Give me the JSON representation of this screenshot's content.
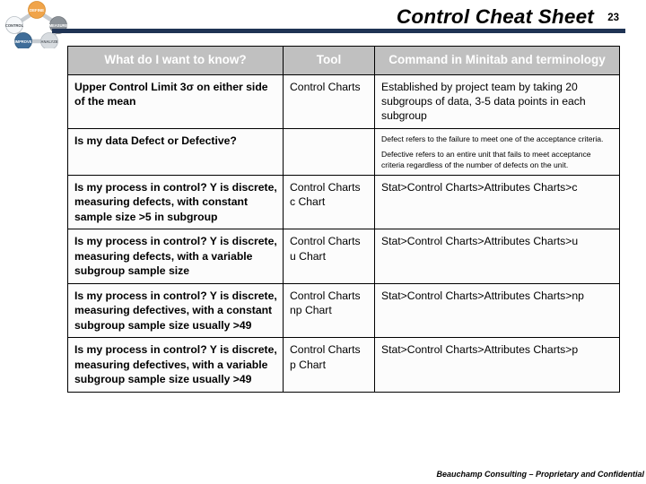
{
  "header": {
    "title": "Control Cheat Sheet",
    "page_number": "23",
    "rule_color": "#1f3354"
  },
  "logo": {
    "name": "dmaic-cycle-logo",
    "nodes": [
      {
        "label": "DEFINE",
        "color": "#f0a44a"
      },
      {
        "label": "MEASURE",
        "color": "#8d9399"
      },
      {
        "label": "ANALYZE",
        "color": "#d8dce0"
      },
      {
        "label": "IMPROVE",
        "color": "#3f6d99"
      },
      {
        "label": "CONTROL",
        "color": "#f2f4f6"
      }
    ]
  },
  "table": {
    "headers": {
      "question": "What do I want to know?",
      "tool": "Tool",
      "command": "Command in Minitab and terminology"
    },
    "rows": [
      {
        "question": "Upper Control Limit 3σ on either side of the mean",
        "tool": "Control Charts",
        "command": "Established by project team by taking 20 subgroups of data, 3-5 data points in each subgroup",
        "command_small": false
      },
      {
        "question": "Is my data Defect or Defective?",
        "tool": "",
        "command_paragraphs": [
          "Defect refers to the failure to meet one of the acceptance criteria.",
          "Defective refers to an entire unit that fails to meet acceptance criteria regardless of the number of defects on the unit."
        ],
        "command_small": true
      },
      {
        "question": "Is my process in control? Y is discrete, measuring defects, with constant sample size >5 in subgroup",
        "tool": "Control Charts c Chart",
        "command": "Stat>Control Charts>Attributes Charts>c",
        "command_small": false
      },
      {
        "question": "Is my process in control? Y is discrete, measuring defects, with a variable subgroup sample size",
        "tool": "Control Charts u Chart",
        "command": "Stat>Control Charts>Attributes Charts>u",
        "command_small": false
      },
      {
        "question": "Is my process in control? Y is discrete, measuring defectives, with a constant subgroup sample size usually >49",
        "tool": "Control Charts np Chart",
        "command": "Stat>Control Charts>Attributes Charts>np",
        "command_small": false
      },
      {
        "question": "Is my process in control? Y is discrete, measuring defectives, with a variable subgroup sample size usually >49",
        "tool": "Control Charts p Chart",
        "command": "Stat>Control Charts>Attributes Charts>p",
        "command_small": false
      }
    ]
  },
  "footer": {
    "note": "Beauchamp Consulting – Proprietary and Confidential"
  }
}
